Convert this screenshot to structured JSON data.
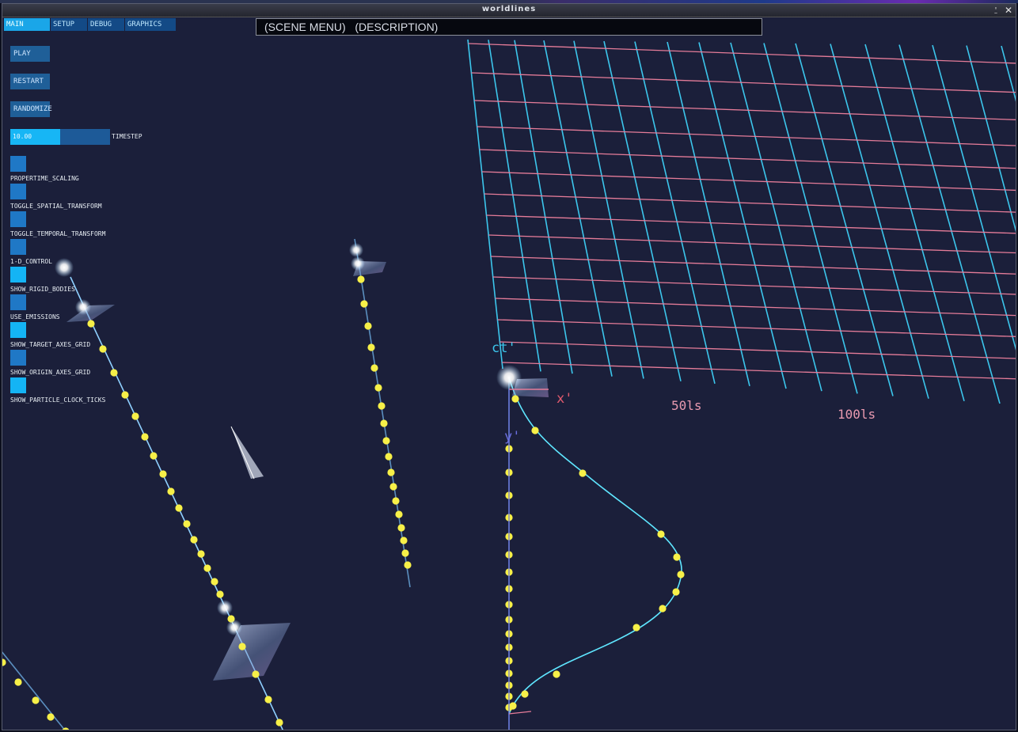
{
  "window": {
    "title": "worldlines"
  },
  "scene_menu": {
    "text": "(SCENE MENU)   (DESCRIPTION)"
  },
  "tabs": [
    {
      "label": "MAIN",
      "active": true
    },
    {
      "label": "SETUP",
      "active": false
    },
    {
      "label": "DEBUG",
      "active": false
    },
    {
      "label": "GRAPHICS",
      "active": false
    }
  ],
  "controls": {
    "play_label": "PLAY",
    "restart_label": "RESTART",
    "randomize_label": "RANDOMIZE",
    "timestep": {
      "value": "10.00",
      "label": "TIMESTEP",
      "fill_fraction": 0.5
    }
  },
  "toggles": [
    {
      "label": "PROPERTIME_SCALING",
      "on": false
    },
    {
      "label": "TOGGLE_SPATIAL_TRANSFORM",
      "on": false
    },
    {
      "label": "TOGGLE_TEMPORAL_TRANSFORM",
      "on": false
    },
    {
      "label": "1-D_CONTROL",
      "on": false
    },
    {
      "label": "SHOW_RIGID_BODIES",
      "on": true
    },
    {
      "label": "USE_EMISSIONS",
      "on": false
    },
    {
      "label": "SHOW_TARGET_AXES_GRID",
      "on": true
    },
    {
      "label": "SHOW_ORIGIN_AXES_GRID",
      "on": false
    },
    {
      "label": "SHOW_PARTICLE_CLOCK_TICKS",
      "on": true
    }
  ],
  "scene_labels": {
    "ct": "ct'",
    "x": "x'",
    "y": "y'",
    "tick_50": "50ls",
    "tick_100": "100ls"
  },
  "colors": {
    "background": "#1b1f3a",
    "grid_cyan": "#3cc6ec",
    "grid_pink": "#e57c99",
    "particle_yellow": "#f7f048",
    "worldline_cyan": "#5fe6ff",
    "tab_active": "#1aa6e8",
    "button": "#1f5f98"
  }
}
